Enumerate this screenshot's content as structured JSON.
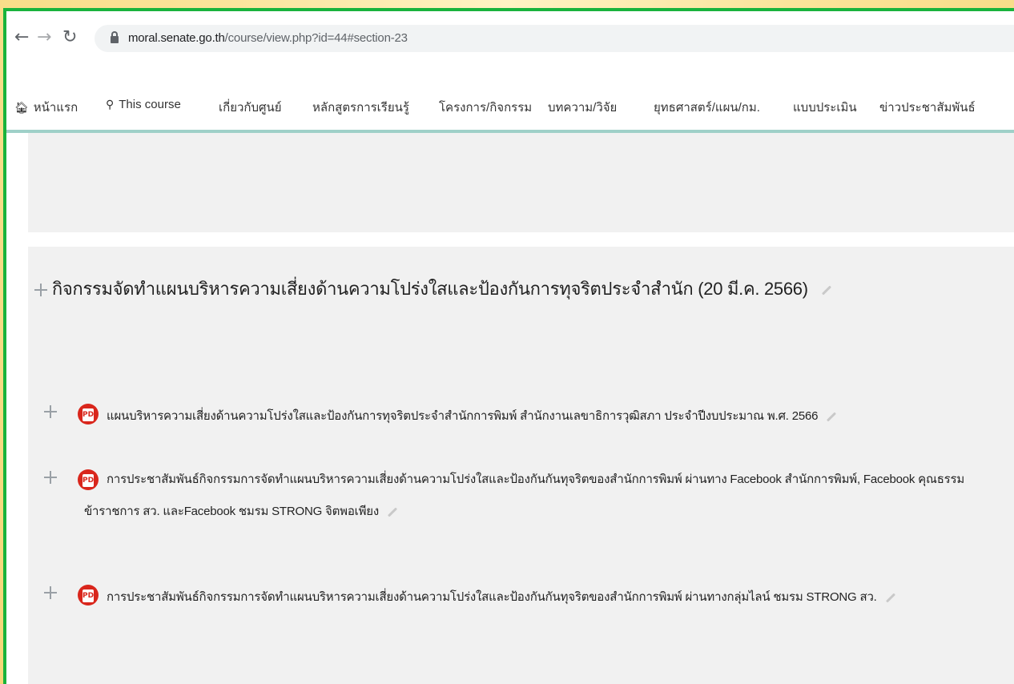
{
  "browser": {
    "url_host": "moral.senate.go.th",
    "url_path": "/course/view.php?id=44#section-23"
  },
  "menu": [
    {
      "label": "หน้าแรก",
      "icon": "home-icon"
    },
    {
      "label": "This course",
      "icon": "sitemap-icon"
    },
    {
      "label": "เกี่ยวกับศูนย์"
    },
    {
      "label": "หลักสูตรการเรียนรู้"
    },
    {
      "label": "โครงการ/กิจกรรม"
    },
    {
      "label": "บทความ/วิจัย"
    },
    {
      "label": "ยุทธศาสตร์/แผน/กม."
    },
    {
      "label": "แบบประเมิน"
    },
    {
      "label": "ข่าวประชาสัมพันธ์"
    }
  ],
  "section": {
    "title": "กิจกรรมจัดทำแผนบริหารความเสี่ยงด้านความโปร่งใสและป้องกันการทุจริตประจำสำนัก (20 มี.ค. 2566)"
  },
  "activities": [
    {
      "text": "แผนบริหารความเสี่ยงด้านความโปร่งใสและป้องกันการทุจริตประจำสำนักการพิมพ์ สำนักงานเลขาธิการวุฒิสภา ประจำปีงบประมาณ พ.ศ. 2566",
      "icon": "pdf-icon"
    },
    {
      "text": "การประชาสัมพันธ์กิจกรรมการจัดทำแผนบริหารความเสี่ยงด้านความโปร่งใสและป้องกันกันทุจริตของสำนักการพิมพ์ ผ่านทาง Facebook สำนักการพิมพ์, Facebook คุณธรรมข้าราชการ สว. และFacebook ชมรม STRONG จิตพอเพียง",
      "icon": "pdf-icon"
    },
    {
      "text": "การประชาสัมพันธ์กิจกรรมการจัดทำแผนบริหารความเสี่ยงด้านความโปร่งใสและป้องกันกันทุจริตของสำนักการพิมพ์ ผ่านทางกลุ่มไลน์ ชมรม STRONG สว.",
      "icon": "pdf-icon"
    }
  ]
}
